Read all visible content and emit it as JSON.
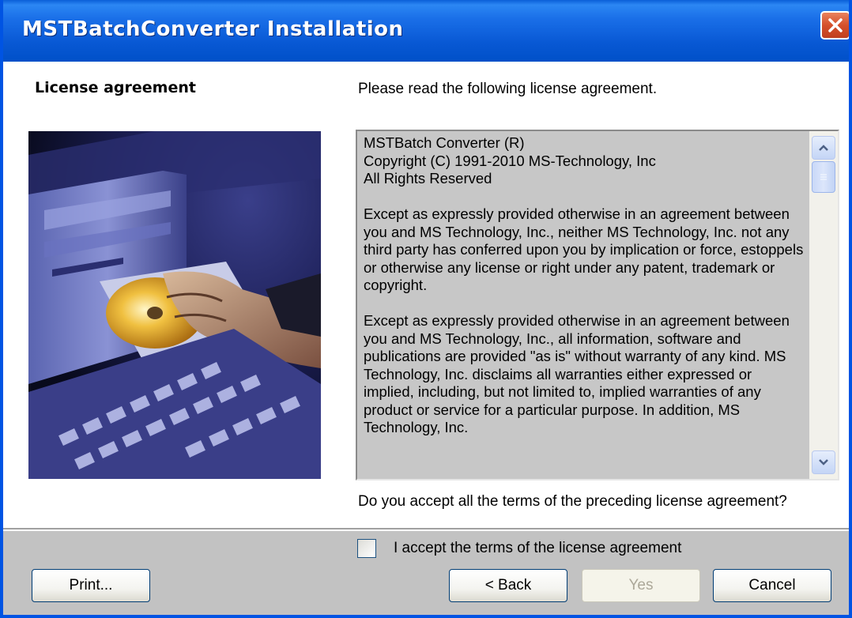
{
  "window": {
    "title": "MSTBatchConverter Installation",
    "close_icon": "close-icon"
  },
  "header": {
    "section_title": "License agreement",
    "instruction": "Please read the following license agreement."
  },
  "license": {
    "paragraphs": [
      "MSTBatch Converter (R)\nCopyright (C) 1991-2010 MS-Technology, Inc\nAll Rights Reserved",
      "Except as expressly provided otherwise in an agreement between you and MS Technology, Inc., neither MS Technology, Inc. not any third party has conferred upon you by implication or force, estoppels or otherwise any license or right under any patent, trademark or copyright.",
      "Except as expressly provided otherwise in an agreement between you and MS Technology, Inc., all information, software and publications are provided \"as is\" without warranty of any kind. MS Technology, Inc. disclaims all warranties either expressed or implied, including, but not limited to, implied warranties of any product or service for a particular purpose. In addition, MS Technology, Inc."
    ]
  },
  "question": "Do you accept all the terms of the preceding license agreement?",
  "accept": {
    "label": "I accept the terms of the license agreement",
    "checked": false
  },
  "buttons": {
    "print": "Print...",
    "back": "< Back",
    "yes": "Yes",
    "cancel": "Cancel"
  },
  "colors": {
    "titlebar": "#0858D4",
    "close_button": "#D5502B",
    "license_background": "#C7C7C7",
    "footer_background": "#C2C2C2"
  }
}
